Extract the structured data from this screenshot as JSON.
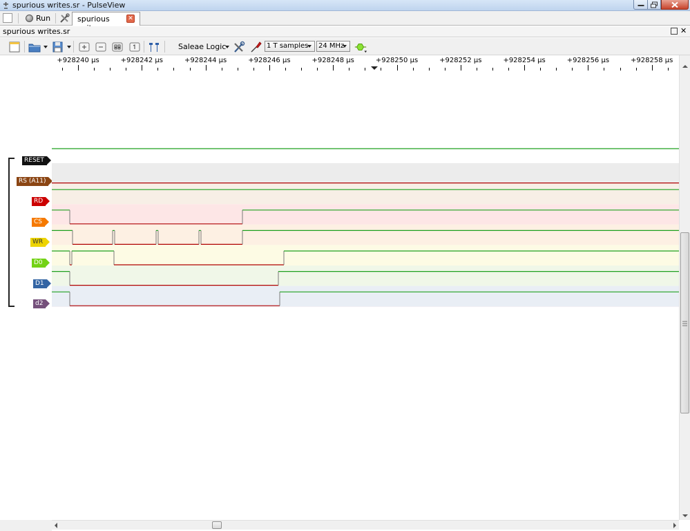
{
  "window": {
    "title": "spurious writes.sr - PulseView"
  },
  "main_toolbar": {
    "run_label": "Run",
    "tab_label": "spurious writes.sr",
    "tab_close_glyph": "✕"
  },
  "document": {
    "header_title": "spurious writes.sr",
    "close_glyph": "✕"
  },
  "view_toolbar": {
    "device": "Saleae Logic",
    "samples": "1 T samples",
    "samplerate": "24 MHz"
  },
  "ruler": {
    "labels": [
      "+928240 µs",
      "+928242 µs",
      "+928244 µs",
      "+928246 µs",
      "+928248 µs",
      "+928250 µs",
      "+928252 µs",
      "+928254 µs",
      "+928256 µs",
      "+928258 µs"
    ]
  },
  "signals": [
    {
      "name": "RESET",
      "color": "#111111"
    },
    {
      "name": "RS (A11)",
      "color": "#8b4513"
    },
    {
      "name": "RD",
      "color": "#cc0000"
    },
    {
      "name": "CS",
      "color": "#f57900"
    },
    {
      "name": "WR",
      "color": "#edd400"
    },
    {
      "name": "D0",
      "color": "#73d216"
    },
    {
      "name": "D1",
      "color": "#3465a4"
    },
    {
      "name": "d2",
      "color": "#75507b"
    }
  ],
  "colors": {
    "high": "#1ea01e",
    "low": "#b00000",
    "row_bg": [
      "#ececec",
      "#f7efe6",
      "#fde6e6",
      "#fdf0e3",
      "#fdfbe4",
      "#f0f7e8",
      "#e9eef5",
      "#f1edf2"
    ]
  }
}
